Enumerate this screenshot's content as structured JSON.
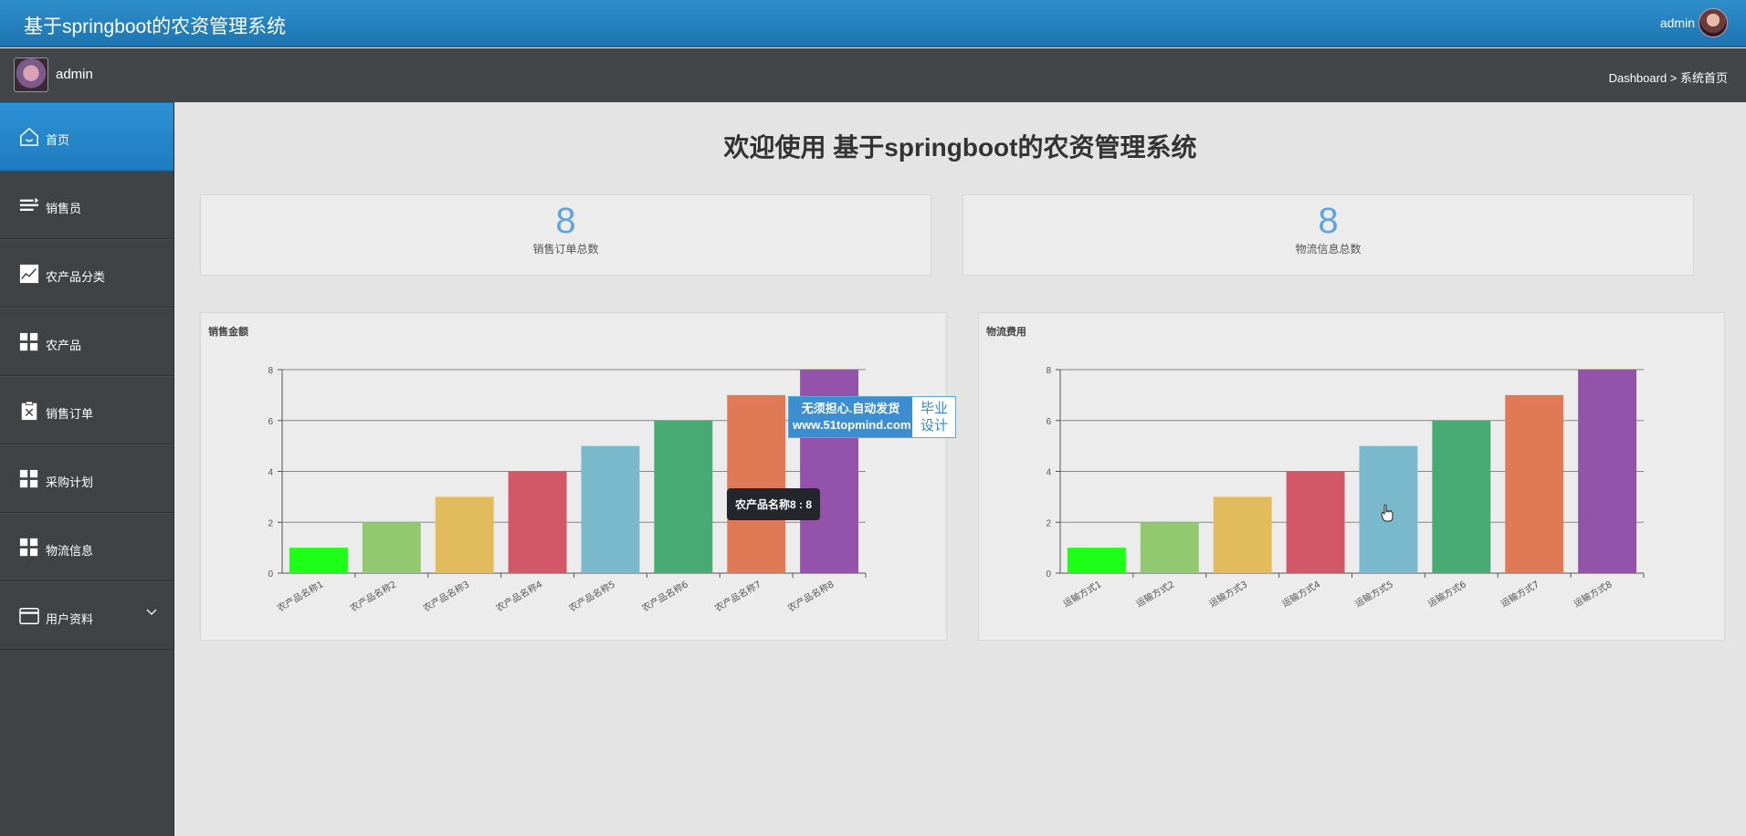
{
  "topbar": {
    "title": "基于springboot的农资管理系统",
    "user": "admin"
  },
  "subbar": {
    "name": "admin",
    "breadcrumb": "Dashboard > 系统首页"
  },
  "sidebar": {
    "items": [
      {
        "label": "首页",
        "icon": "home-icon",
        "active": true
      },
      {
        "label": "销售员",
        "icon": "list-icon"
      },
      {
        "label": "农产品分类",
        "icon": "chart-line-icon"
      },
      {
        "label": "农产品",
        "icon": "grid-icon"
      },
      {
        "label": "销售订单",
        "icon": "clipboard-icon"
      },
      {
        "label": "采购计划",
        "icon": "grid-icon"
      },
      {
        "label": "物流信息",
        "icon": "grid-icon"
      },
      {
        "label": "用户资料",
        "icon": "card-icon",
        "chevron": "chevron-down-icon"
      }
    ]
  },
  "main": {
    "welcome": "欢迎使用 基于springboot的农资管理系统",
    "stats": [
      {
        "value": "8",
        "label": "销售订单总数"
      },
      {
        "value": "8",
        "label": "物流信息总数"
      }
    ]
  },
  "tooltip": "农产品名称8 : 8",
  "watermark": {
    "left_line1": "无须担心.自动发货",
    "left_line2": "www.51topmind.com",
    "right_line1": "毕业",
    "right_line2": "设计"
  },
  "colors": [
    "#1dff16",
    "#91c870",
    "#e2bc5c",
    "#d25868",
    "#79b9cb",
    "#48ab73",
    "#e07a56",
    "#9453ab"
  ],
  "chart_data": [
    {
      "type": "bar",
      "title": "销售金额",
      "categories": [
        "农产品名称1",
        "农产品名称2",
        "农产品名称3",
        "农产品名称4",
        "农产品名称5",
        "农产品名称6",
        "农产品名称7",
        "农产品名称8"
      ],
      "values": [
        1,
        2,
        3,
        4,
        5,
        6,
        7,
        8
      ],
      "ylim": [
        0,
        8
      ],
      "yticks": [
        0,
        2,
        4,
        6,
        8
      ],
      "grid": true,
      "legend": "none"
    },
    {
      "type": "bar",
      "title": "物流费用",
      "categories": [
        "运输方式1",
        "运输方式2",
        "运输方式3",
        "运输方式4",
        "运输方式5",
        "运输方式6",
        "运输方式7",
        "运输方式8"
      ],
      "values": [
        1,
        2,
        3,
        4,
        5,
        6,
        7,
        8
      ],
      "ylim": [
        0,
        8
      ],
      "yticks": [
        0,
        2,
        4,
        6,
        8
      ],
      "grid": true,
      "legend": "none"
    }
  ]
}
